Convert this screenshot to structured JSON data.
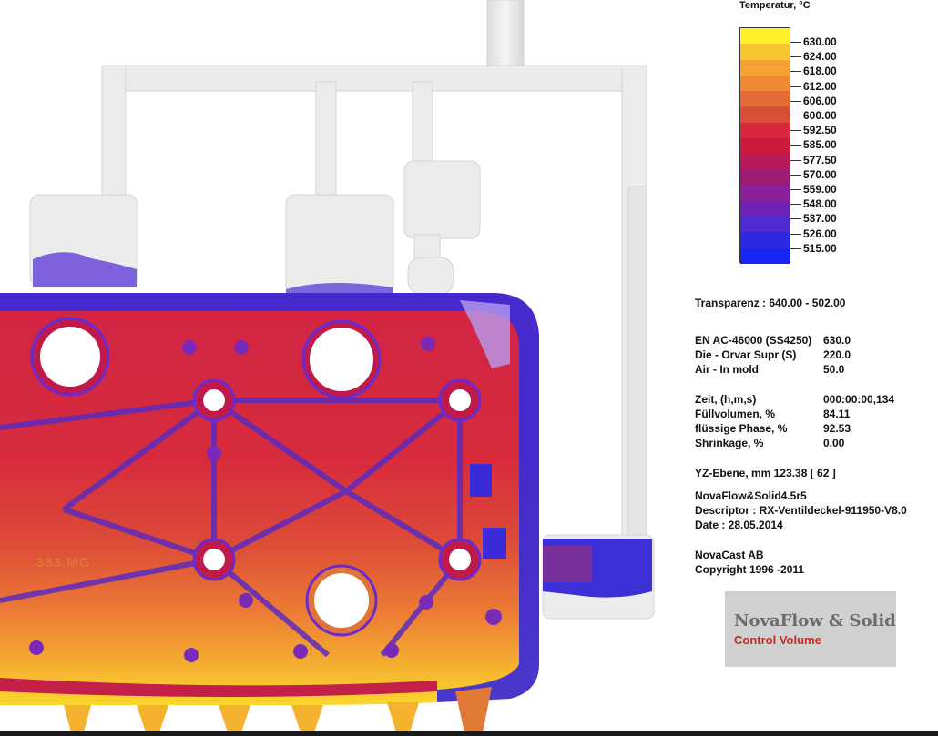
{
  "legend": {
    "title": "Temperatur, °C",
    "ticks": [
      "630.00",
      "624.00",
      "618.00",
      "612.00",
      "606.00",
      "600.00",
      "592.50",
      "585.00",
      "577.50",
      "570.00",
      "559.00",
      "548.00",
      "537.00",
      "526.00",
      "515.00"
    ],
    "colors": [
      "#fdf22a",
      "#f8c632",
      "#f3a233",
      "#ee8a34",
      "#e46a36",
      "#d84f37",
      "#d9283d",
      "#cb1b3f",
      "#b81a55",
      "#9d1b73",
      "#8a219a",
      "#6c23b4",
      "#4e2bd0",
      "#2b29e2",
      "#1626f0"
    ]
  },
  "info": {
    "transparency": "Transparenz :  640.00 -  502.00",
    "materials": [
      {
        "k": "EN AC-46000 (SS4250)",
        "v": "630.0"
      },
      {
        "k": "Die - Orvar Supr (S)",
        "v": "220.0"
      },
      {
        "k": "Air - In mold",
        "v": "50.0"
      }
    ],
    "stats": [
      {
        "k": "Zeit, (h,m,s)",
        "v": "000:00:00,134"
      },
      {
        "k": "Füllvolumen, %",
        "v": "84.11"
      },
      {
        "k": "flüssige Phase, %",
        "v": "92.53"
      },
      {
        "k": "Shrinkage, %",
        "v": "0.00"
      }
    ],
    "plane": "YZ-Ebene, mm  123.38   [ 62 ]",
    "software": "NovaFlow&Solid4.5r5",
    "descriptor": "Descriptor : RX-Ventildeckel-911950-V8.0",
    "date": "Date : 28.05.2014",
    "company": "NovaCast AB",
    "copyright": "Copyright 1996 -2011"
  },
  "logo": {
    "title": "NovaFlow & Solid",
    "subtitle": "Control Volume"
  },
  "part_marking": "383.MG"
}
